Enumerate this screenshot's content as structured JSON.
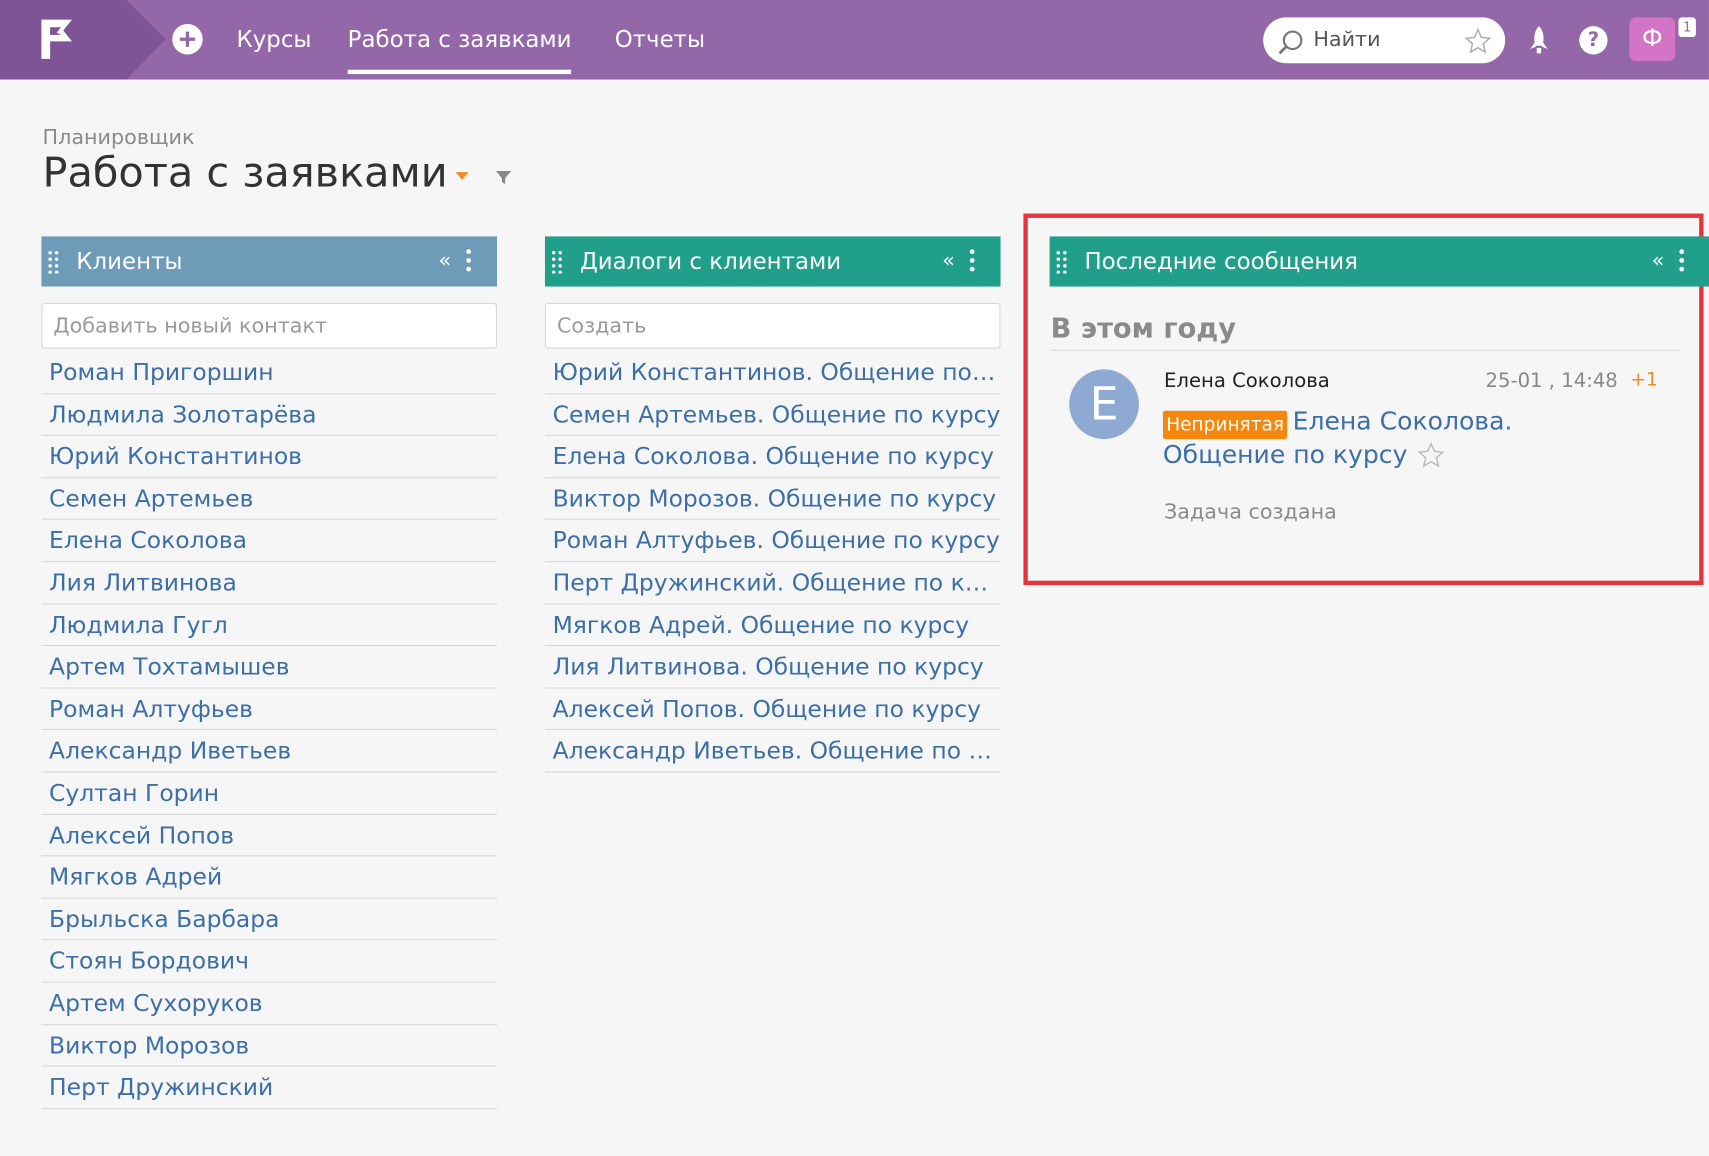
{
  "colors": {
    "topbar": "#9468a8",
    "clients_header": "#6e9cb8",
    "teal_header": "#20a08a",
    "link": "#3c6fa8",
    "status_orange": "#f5870f",
    "highlight_red": "#e8323c"
  },
  "topbar": {
    "logo_icon": "flag-logo-icon",
    "add_icon": "plus-circle-icon",
    "nav": [
      {
        "label": "Курсы"
      },
      {
        "label": "Работа с заявками"
      },
      {
        "label": "Отчеты"
      }
    ],
    "search": {
      "label": "Найти",
      "icon": "search-icon",
      "star_icon": "star-icon"
    },
    "rocket_icon": "rocket-icon",
    "help_label": "?",
    "user_avatar": "Ф",
    "notification_count": "1"
  },
  "page": {
    "breadcrumb": "Планировщик",
    "title": "Работа с заявками"
  },
  "clients": {
    "title": "Клиенты",
    "collapse": "«",
    "input_placeholder": "Добавить новый контакт",
    "items": [
      "Роман Пригоршин",
      "Людмила Золотарёва",
      "Юрий Константинов",
      "Семен Артемьев",
      "Елена Соколова",
      "Лия Литвинова",
      "Людмила Гугл",
      "Артем Тохтамышев",
      "Роман Алтуфьев",
      "Александр Иветьев",
      "Султан Горин",
      "Алексей Попов",
      "Мягков Адрей",
      "Брыльска Барбара",
      "Стоян Бордович",
      "Артем Сухоруков",
      "Виктор Морозов",
      "Перт Дружинский"
    ]
  },
  "dialogs": {
    "title": "Диалоги с клиентами",
    "collapse": "«",
    "input_placeholder": "Создать",
    "items": [
      "Юрий Константинов. Общение по курсу",
      "Семен Артемьев. Общение по курсу",
      "Елена Соколова. Общение по курсу",
      "Виктор Морозов. Общение по курсу",
      "Роман Алтуфьев. Общение по курсу",
      "Перт Дружинский. Общение по курсу",
      "Мягков Адрей. Общение по курсу",
      "Лия Литвинова. Общение по курсу",
      "Алексей Попов. Общение по курсу",
      "Александр Иветьев. Общение по курсу"
    ]
  },
  "messages": {
    "title": "Последние сообщения",
    "collapse": "«",
    "section": "В этом году",
    "item": {
      "avatar_letter": "Е",
      "author": "Елена Соколова",
      "time": "25-01 , 14:48",
      "plus": "+1",
      "status": "Непринятая",
      "subject_line1": "Елена Соколова.",
      "subject_line2": "Общение по курсу",
      "note": "Задача создана"
    }
  }
}
